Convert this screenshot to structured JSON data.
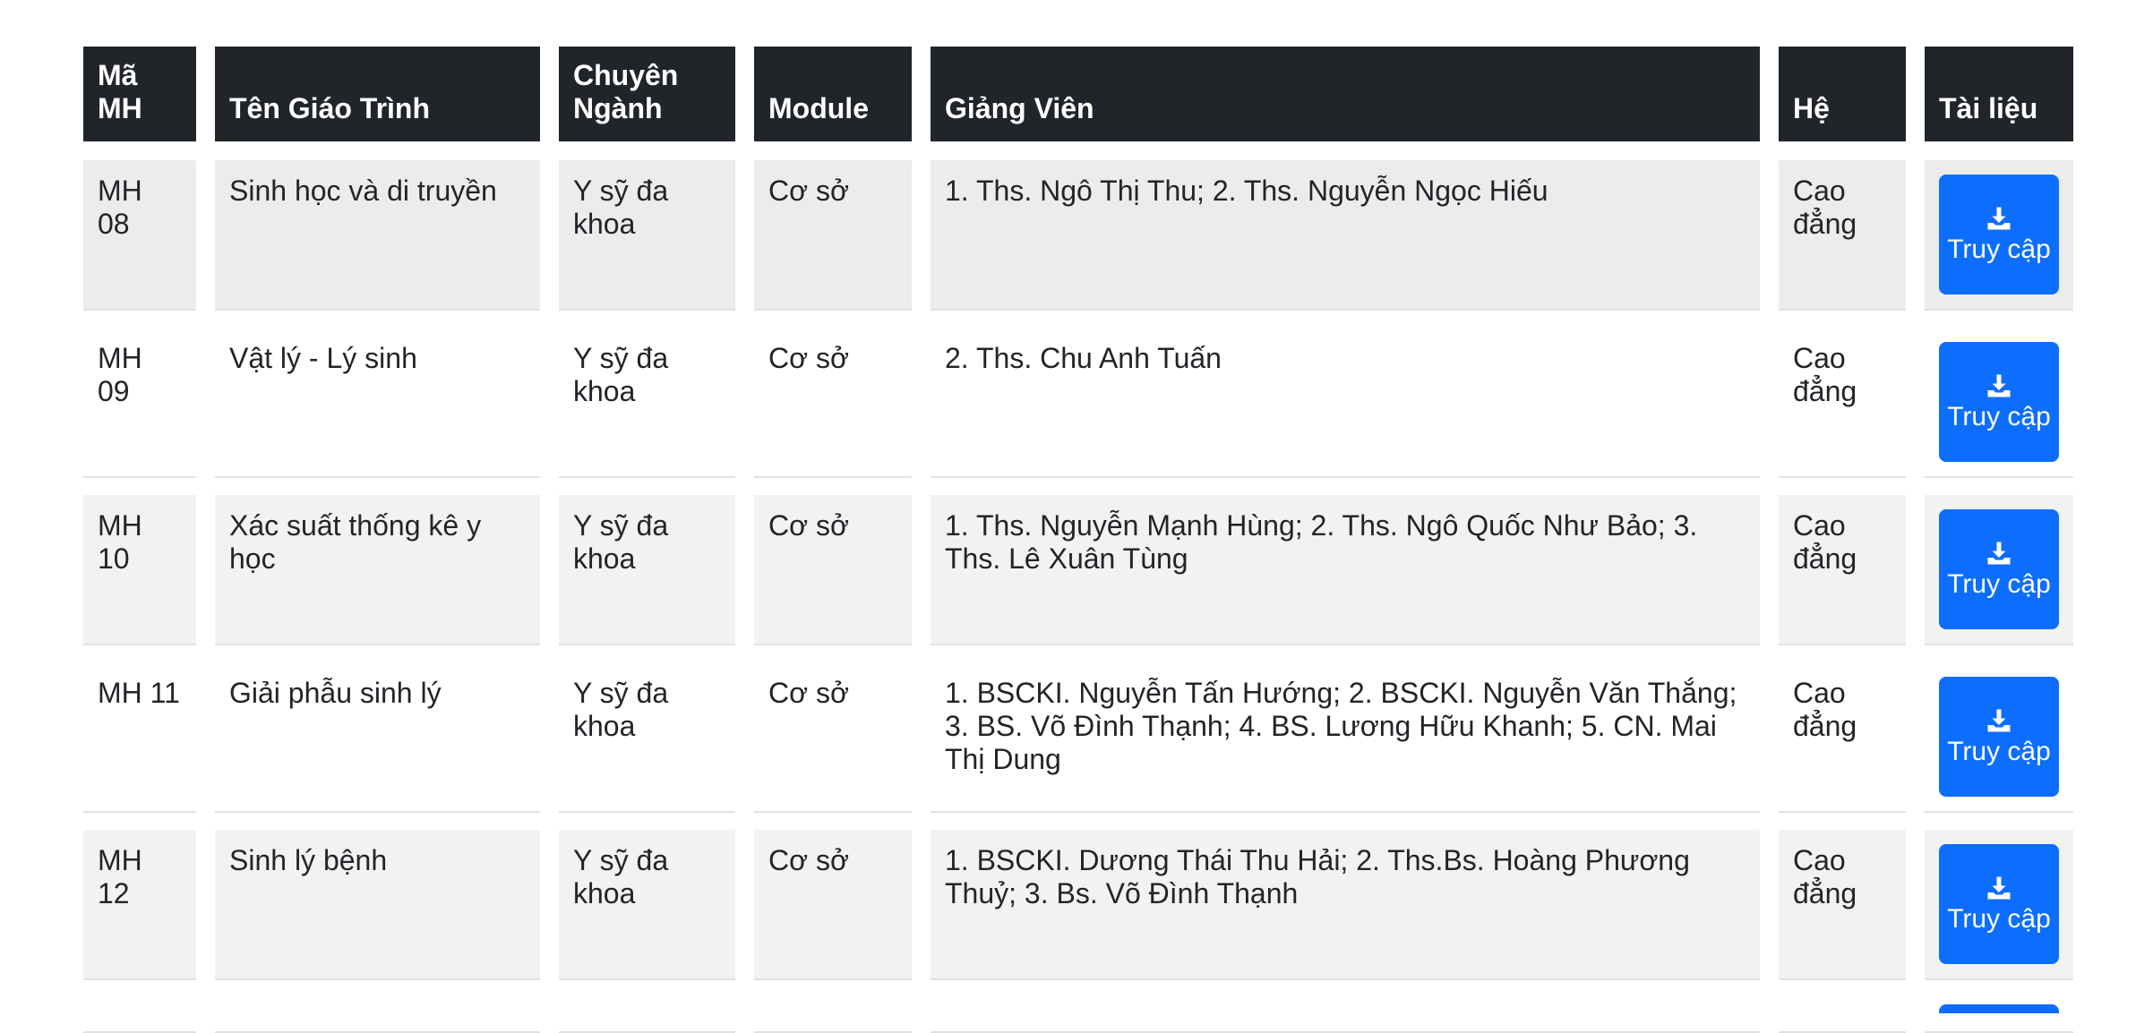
{
  "table": {
    "headers": {
      "ma": "Mã MH",
      "ten": "Tên Giáo Trình",
      "chuyen_nganh": "Chuyên Ngành",
      "module": "Module",
      "giang_vien": "Giảng Viên",
      "he": "Hệ",
      "tai_lieu": "Tài liệu"
    },
    "rows": [
      {
        "ma": "MH 08",
        "ten": "Sinh học và di truyền",
        "chuyen_nganh": "Y sỹ đa khoa",
        "module": "Cơ sở",
        "giang_vien": "1. Ths. Ngô Thị Thu; 2. Ths. Nguyễn Ngọc Hiếu",
        "he": "Cao đẳng",
        "button": "Truy cập"
      },
      {
        "ma": "MH 09",
        "ten": "Vật lý - Lý sinh",
        "chuyen_nganh": "Y sỹ đa khoa",
        "module": "Cơ sở",
        "giang_vien": "2. Ths. Chu Anh Tuấn",
        "he": "Cao đẳng",
        "button": "Truy cập"
      },
      {
        "ma": "MH 10",
        "ten": "Xác suất thống kê y học",
        "chuyen_nganh": "Y sỹ đa khoa",
        "module": "Cơ sở",
        "giang_vien": "1. Ths. Nguyễn Mạnh Hùng; 2. Ths. Ngô Quốc Như Bảo; 3. Ths. Lê Xuân Tùng",
        "he": "Cao đẳng",
        "button": "Truy cập"
      },
      {
        "ma": "MH 11",
        "ten": "Giải phẫu sinh lý",
        "chuyen_nganh": "Y sỹ đa khoa",
        "module": "Cơ sở",
        "giang_vien": "1. BSCKI. Nguyễn Tấn Hướng; 2. BSCKI. Nguyễn Văn Thắng; 3. BS. Võ Đình Thạnh; 4. BS. Lương Hữu Khanh; 5. CN. Mai Thị Dung",
        "he": "Cao đẳng",
        "button": "Truy cập"
      },
      {
        "ma": "MH 12",
        "ten": "Sinh lý bệnh",
        "chuyen_nganh": "Y sỹ đa khoa",
        "module": "Cơ sở",
        "giang_vien": "1. BSCKI. Dương Thái Thu Hải; 2. Ths.Bs. Hoàng Phương Thuỷ; 3. Bs. Võ Đình Thạnh",
        "he": "Cao đẳng",
        "button": "Truy cập"
      }
    ]
  },
  "icons": {
    "download": "download-icon"
  },
  "colors": {
    "header_bg": "#212529",
    "button_bg": "#0d6efd",
    "stripe_bg": "#f2f2f2"
  }
}
